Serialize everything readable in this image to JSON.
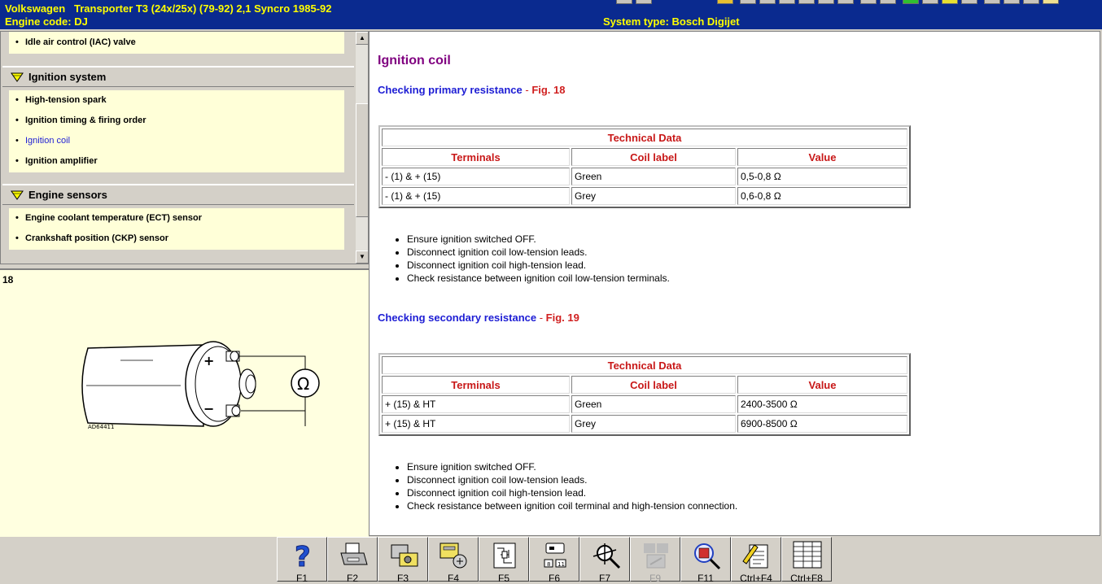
{
  "header": {
    "vehicle": "Volkswagen   Transporter T3 (24x/25x) (79-92) 2,1 Syncro 1985-92",
    "engine_code": "Engine code: DJ",
    "system_type": "System type: Bosch Digijet"
  },
  "nav": {
    "prev_item": "Idle air control (IAC) valve",
    "groups": [
      {
        "label": "Ignition system",
        "items": [
          "High-tension spark",
          "Ignition timing & firing order",
          "Ignition coil",
          "Ignition amplifier"
        ],
        "active_index": 2
      },
      {
        "label": "Engine sensors",
        "items": [
          "Engine coolant temperature (ECT) sensor",
          "Crankshaft position (CKP) sensor"
        ]
      }
    ]
  },
  "figure": {
    "number": "18",
    "code": "AD64411",
    "plus": "+",
    "minus": "−",
    "ohm": "Ω"
  },
  "main": {
    "title": "Ignition coil",
    "sections": [
      {
        "heading": "Checking primary resistance",
        "dash": " - ",
        "fig": "Fig. 18",
        "table": {
          "caption": "Technical Data",
          "headers": [
            "Terminals",
            "Coil label",
            "Value"
          ],
          "rows": [
            [
              "- (1) & + (15)",
              "Green",
              "0,5-0,8 Ω"
            ],
            [
              "- (1) & + (15)",
              "Grey",
              "0,6-0,8 Ω"
            ]
          ]
        },
        "steps": [
          "Ensure ignition switched OFF.",
          "Disconnect ignition coil low-tension leads.",
          "Disconnect ignition coil high-tension lead.",
          "Check resistance between ignition coil low-tension terminals."
        ]
      },
      {
        "heading": "Checking secondary resistance",
        "dash": " - ",
        "fig": "Fig. 19",
        "table": {
          "caption": "Technical Data",
          "headers": [
            "Terminals",
            "Coil label",
            "Value"
          ],
          "rows": [
            [
              "+ (15) & HT",
              "Green",
              "2400-3500 Ω"
            ],
            [
              "+ (15) & HT",
              "Grey",
              "6900-8500 Ω"
            ]
          ]
        },
        "steps": [
          "Ensure ignition switched OFF.",
          "Disconnect ignition coil low-tension leads.",
          "Disconnect ignition coil high-tension lead.",
          "Check resistance between ignition coil terminal and high-tension connection."
        ]
      }
    ]
  },
  "fkeys": [
    {
      "label": "F1",
      "icon": "help-icon"
    },
    {
      "label": "F2",
      "icon": "printer-icon"
    },
    {
      "label": "F3",
      "icon": "component-location-icon"
    },
    {
      "label": "F4",
      "icon": "component-data-icon"
    },
    {
      "label": "F5",
      "icon": "wiring-diagram-icon"
    },
    {
      "label": "F6",
      "icon": "connector-pins-icon"
    },
    {
      "label": "F7",
      "icon": "diagnosis-probe-icon"
    },
    {
      "label": "F9",
      "icon": "disabled-tool-icon",
      "disabled": true
    },
    {
      "label": "F11",
      "icon": "magnify-component-icon"
    },
    {
      "label": "Ctrl+F4",
      "icon": "notes-pencil-icon"
    },
    {
      "label": "Ctrl+F8",
      "icon": "data-table-icon"
    }
  ]
}
